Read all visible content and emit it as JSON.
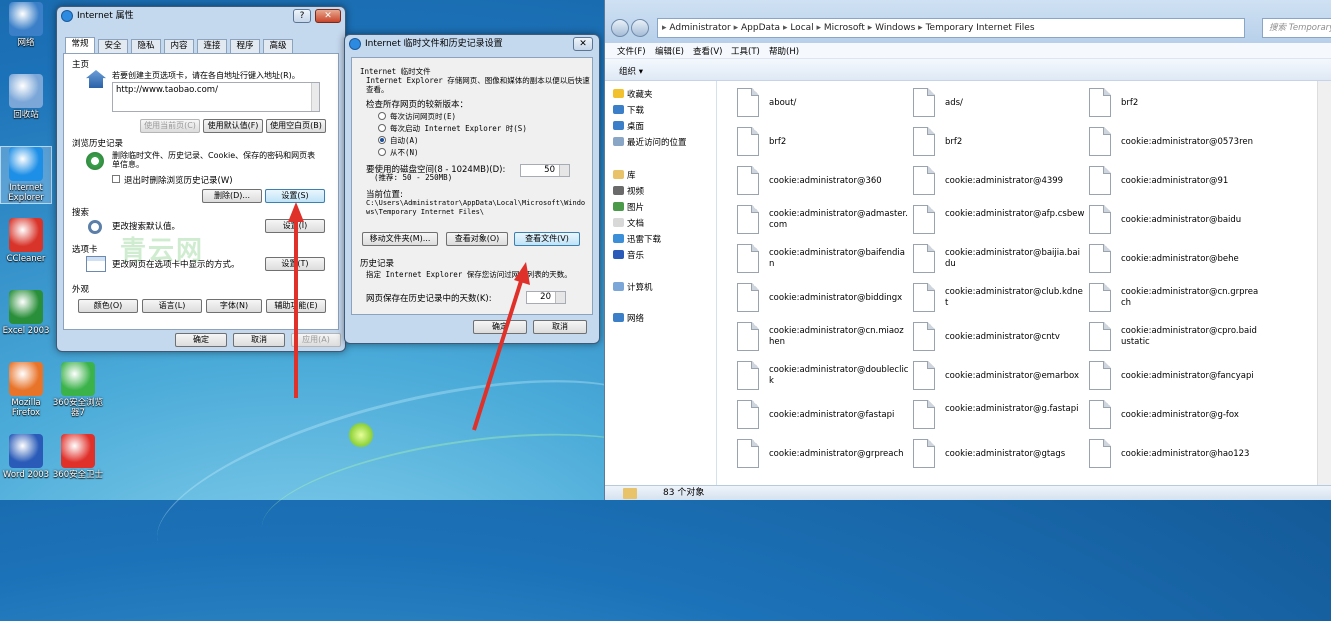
{
  "desktop": [
    {
      "label": "网络",
      "icon": "network-icon"
    },
    {
      "label": "回收站",
      "icon": "recycle-bin-icon"
    },
    {
      "label": "Internet Explorer",
      "icon": "internet-explorer-icon"
    },
    {
      "label": "CCleaner",
      "icon": "ccleaner-icon"
    },
    {
      "label": "Excel 2003",
      "icon": "excel-icon"
    },
    {
      "label": "Mozilla Firefox",
      "icon": "firefox-icon"
    },
    {
      "label": "360安全浏览器7",
      "icon": "360-browser-icon"
    },
    {
      "label": "Word 2003",
      "icon": "word-icon"
    },
    {
      "label": "360安全卫士",
      "icon": "360-security-icon"
    }
  ],
  "ie_options": {
    "title": "Internet 属性",
    "help": "?",
    "close": "✕",
    "tabs": [
      "常规",
      "安全",
      "隐私",
      "内容",
      "连接",
      "程序",
      "高级"
    ],
    "home_group": "主页",
    "home_desc": "若要创建主页选项卡，请在各自地址行键入地址(R)。",
    "home_url": "http://www.taobao.com/",
    "btn_use_current": "使用当前页(C)",
    "btn_use_default": "使用默认值(F)",
    "btn_use_blank": "使用空白页(B)",
    "history_group": "浏览历史记录",
    "history_desc": "删除临时文件、历史记录、Cookie、保存的密码和网页表单信息。",
    "history_exit_check": "退出时删除浏览历史记录(W)",
    "btn_delete": "删除(D)...",
    "btn_settings": "设置(S)",
    "search_group": "搜索",
    "search_desc": "更改搜索默认值。",
    "btn_search_settings": "设置(I)",
    "tabs_group": "选项卡",
    "tabs_desc": "更改网页在选项卡中显示的方式。",
    "btn_tabs_settings": "设置(T)",
    "appearance_group": "外观",
    "btn_colors": "颜色(O)",
    "btn_languages": "语言(L)",
    "btn_fonts": "字体(N)",
    "btn_accessibility": "辅助功能(E)",
    "btn_ok": "确定",
    "btn_cancel": "取消",
    "btn_apply": "应用(A)"
  },
  "watermark": "青云网",
  "temp_settings": {
    "title": "Internet 临时文件和历史记录设置",
    "close": "✕",
    "temp_group": "Internet 临时文件",
    "temp_desc": "Internet Explorer 存储网页、图像和媒体的副本以便以后快速查看。",
    "check_newer": "检查所存网页的较新版本：",
    "radio_every_visit": "每次访问网页时(E)",
    "radio_every_start": "每次启动 Internet Explorer 时(S)",
    "radio_auto": "自动(A)",
    "radio_never": "从不(N)",
    "disk_label": "要使用的磁盘空间(8 - 1024MB)(D):",
    "disk_recommend": "(推荐: 50 - 250MB)",
    "disk_value": "50",
    "location_label": "当前位置:",
    "location_path": "C:\\Users\\Administrator\\AppData\\Local\\Microsoft\\Windows\\Temporary Internet Files\\",
    "btn_move": "移动文件夹(M)...",
    "btn_view_objects": "查看对象(O)",
    "btn_view_files": "查看文件(V)",
    "history_group": "历史记录",
    "history_desc": "指定 Internet Explorer 保存您访问过网站列表的天数。",
    "days_label": "网页保存在历史记录中的天数(K):",
    "days_value": "20",
    "btn_ok": "确定",
    "btn_cancel": "取消"
  },
  "explorer": {
    "path": [
      "Administrator",
      "AppData",
      "Local",
      "Microsoft",
      "Windows",
      "Temporary Internet Files"
    ],
    "search_placeholder": "搜索 Temporary",
    "menu": [
      "文件(F)",
      "编辑(E)",
      "查看(V)",
      "工具(T)",
      "帮助(H)"
    ],
    "organize": "组织 ▾",
    "nav": [
      {
        "label": "收藏夹",
        "icon": "favorites-star-icon"
      },
      {
        "label": "下载",
        "icon": "downloads-folder-icon"
      },
      {
        "label": "桌面",
        "icon": "desktop-icon"
      },
      {
        "label": "最近访问的位置",
        "icon": "recent-places-icon"
      },
      {
        "label": "库",
        "icon": "libraries-icon"
      },
      {
        "label": "视频",
        "icon": "videos-icon"
      },
      {
        "label": "图片",
        "icon": "pictures-icon"
      },
      {
        "label": "文档",
        "icon": "documents-icon"
      },
      {
        "label": "迅雷下载",
        "icon": "thunder-download-icon"
      },
      {
        "label": "音乐",
        "icon": "music-icon"
      },
      {
        "label": "计算机",
        "icon": "computer-icon"
      },
      {
        "label": "网络",
        "icon": "network-icon"
      }
    ],
    "files": [
      "about/",
      "ads/",
      "brf2",
      "brf2",
      "brf2",
      "cookie:administrator@0573ren",
      "cookie:administrator@360",
      "cookie:administrator@4399",
      "cookie:administrator@91",
      "cookie:administrator@admaster.com",
      "cookie:administrator@afp.csbew",
      "cookie:administrator@baidu",
      "cookie:administrator@baifendian",
      "cookie:administrator@baijia.baidu",
      "cookie:administrator@behe",
      "cookie:administrator@biddingx",
      "cookie:administrator@club.kdnet",
      "cookie:administrator@cn.grpreach",
      "cookie:administrator@cn.miaozhen",
      "cookie:administrator@cntv",
      "cookie:administrator@cpro.baidustatic",
      "cookie:administrator@doubleclick",
      "cookie:administrator@emarbox",
      "cookie:administrator@fancyapi",
      "cookie:administrator@fastapi",
      "cookie:administrator@g.fastapi",
      "cookie:administrator@g-fox",
      "cookie:administrator@grpreach",
      "cookie:administrator@gtags",
      "cookie:administrator@hao123"
    ],
    "status": "83 个对象"
  }
}
